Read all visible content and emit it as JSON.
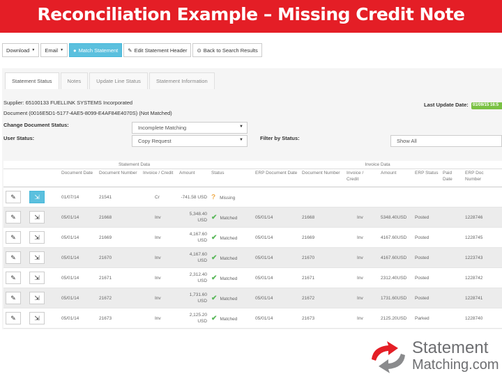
{
  "slide": {
    "title": "Reconciliation Example – Missing Credit Note"
  },
  "toolbar": {
    "download": "Download",
    "email": "Email",
    "match_statement": "Match Statement",
    "edit_header": "Edit Statement Header",
    "back": "Back to Search Results"
  },
  "tabs": [
    "Statement Status",
    "Notes",
    "Update Line Status",
    "Statement Information"
  ],
  "info": {
    "supplier": "Supplier: 65100133 FUELLINK SYSTEMS Incorporated",
    "document": "Document (0016E5D1-5177-4AE5-8099-E4AF84E4070S) (Not Matched)",
    "last_update_label": "Last Update Date:",
    "last_update_value": "01/09/15 16:5",
    "change_status_label": "Change Document Status:",
    "change_status_value": "Incomplete Matching",
    "user_status_label": "User Status:",
    "user_status_value": "Copy Request",
    "filter_label": "Filter by Status:",
    "filter_value": "Show All"
  },
  "table": {
    "group_statement": "Statement Data",
    "group_invoice": "Invoice Data",
    "headers": [
      "",
      "",
      "Document Date",
      "Document Number",
      "Invoice / Credit",
      "Amount",
      "Status",
      "ERP Document Date",
      "Document Number",
      "Invoice / Credit",
      "Amount",
      "ERP Status",
      "Paid Date",
      "ERP Doc Number"
    ],
    "rows": [
      {
        "doc_date": "01/07/14",
        "doc_num": "21541",
        "ic": "Cr",
        "amount": "-741.58 USD",
        "status": "Missing",
        "erp_date": "",
        "inv_num": "",
        "inv_ic": "",
        "inv_amount": "",
        "erp_status": "",
        "paid": "",
        "erp_num": ""
      },
      {
        "doc_date": "05/01/14",
        "doc_num": "21668",
        "ic": "Inv",
        "amount": "5,348.40 USD",
        "status": "Matched",
        "erp_date": "05/01/14",
        "inv_num": "21668",
        "inv_ic": "Inv",
        "inv_amount": "5348.40USD",
        "erp_status": "Posted",
        "paid": "",
        "erp_num": "1228746"
      },
      {
        "doc_date": "05/01/14",
        "doc_num": "21669",
        "ic": "Inv",
        "amount": "4,167.60 USD",
        "status": "Matched",
        "erp_date": "05/01/14",
        "inv_num": "21669",
        "inv_ic": "Inv",
        "inv_amount": "4167.60USD",
        "erp_status": "Posted",
        "paid": "",
        "erp_num": "1228745"
      },
      {
        "doc_date": "05/01/14",
        "doc_num": "21670",
        "ic": "Inv",
        "amount": "4,167.60 USD",
        "status": "Matched",
        "erp_date": "05/01/14",
        "inv_num": "21670",
        "inv_ic": "Inv",
        "inv_amount": "4167.60USD",
        "erp_status": "Posted",
        "paid": "",
        "erp_num": "1223743"
      },
      {
        "doc_date": "05/01/14",
        "doc_num": "21671",
        "ic": "Inv",
        "amount": "2,312.40 USD",
        "status": "Matched",
        "erp_date": "05/01/14",
        "inv_num": "21671",
        "inv_ic": "Inv",
        "inv_amount": "2312.40USD",
        "erp_status": "Posted",
        "paid": "",
        "erp_num": "1228742"
      },
      {
        "doc_date": "05/01/14",
        "doc_num": "21672",
        "ic": "Inv",
        "amount": "1,731.60 USD",
        "status": "Matched",
        "erp_date": "05/01/14",
        "inv_num": "21672",
        "inv_ic": "Inv",
        "inv_amount": "1731.60USD",
        "erp_status": "Posted",
        "paid": "",
        "erp_num": "1228741"
      },
      {
        "doc_date": "05/01/14",
        "doc_num": "21673",
        "ic": "Inv",
        "amount": "2,125.20 USD",
        "status": "Matched",
        "erp_date": "05/01/14",
        "inv_num": "21673",
        "inv_ic": "Inv",
        "inv_amount": "2125.20USD",
        "erp_status": "Parked",
        "paid": "",
        "erp_num": "1228740"
      }
    ]
  },
  "logo": {
    "line1": "Statement",
    "line2": "Matching.com"
  },
  "colors": {
    "title_bg": "#e41e26",
    "primary_button": "#5bc0de",
    "matched": "#5cb85c",
    "badge": "#7ac143"
  }
}
